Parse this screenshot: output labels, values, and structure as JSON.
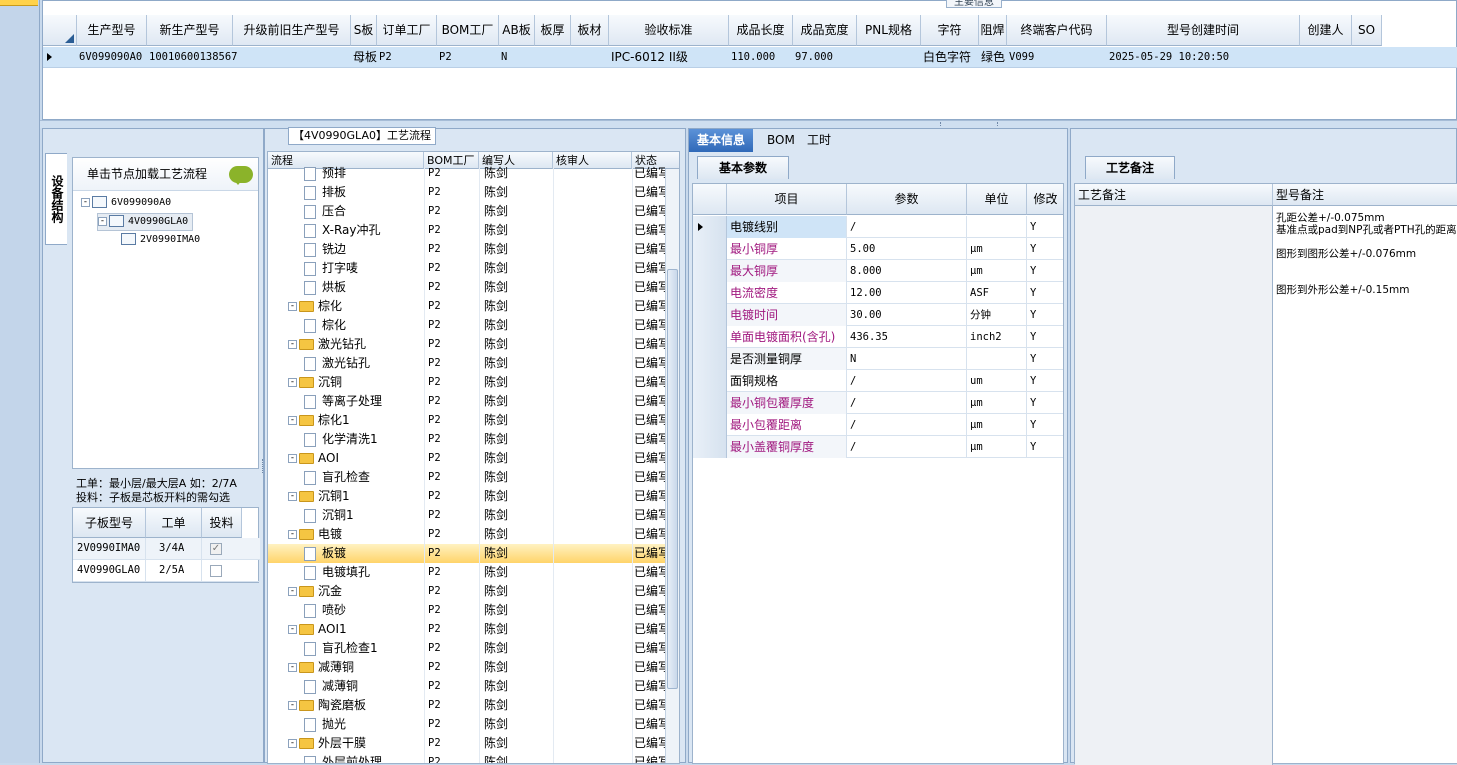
{
  "top": {
    "title_tab": "主要信息",
    "columns": [
      "生产型号",
      "新生产型号",
      "升级前旧生产型号",
      "S板",
      "订单工厂",
      "BOM工厂",
      "AB板",
      "板厚",
      "板材",
      "验收标准",
      "成品长度",
      "成品宽度",
      "PNL规格",
      "字符",
      "阻焊",
      "终端客户代码",
      "型号创建时间",
      "创建人",
      "SO"
    ],
    "row": {
      "production_model": "6V099090A0",
      "new_model": "10010600138567",
      "old_model": "",
      "s_board": "母板",
      "order_factory": "P2",
      "bom_factory": "P2",
      "ab_board": "N",
      "thickness": "",
      "material": "",
      "acceptance": "IPC-6012 II级",
      "length": "110.000",
      "width": "97.000",
      "pnl": "",
      "char": "白色字符",
      "solder": "绿色",
      "customer": "V099",
      "created_time": "2025-05-29 10:20:50",
      "creator": "",
      "so": ""
    }
  },
  "left": {
    "vertical_tab": "设备结构",
    "load_label": "单击节点加载工艺流程",
    "tree": [
      "6V099090A0",
      "4V0990GLA0",
      "2V0990IMA0"
    ],
    "info_line1": "工单：最小层/最大层A 如：2/7A",
    "info_line2": "投料：子板是芯板开料的需勾选",
    "sub_headers": [
      "子板型号",
      "工单",
      "投料"
    ],
    "sub_rows": [
      {
        "model": "2V0990IMA0",
        "order": "3/4A",
        "checked": true
      },
      {
        "model": "4V0990GLA0",
        "order": "2/5A",
        "checked": false
      }
    ]
  },
  "flow": {
    "title": "【4V0990GLA0】工艺流程",
    "headers": [
      "流程",
      "BOM工厂",
      "编写人",
      "核审人",
      "状态"
    ],
    "rows": [
      {
        "name": "预排",
        "level": 2,
        "folder": false,
        "bom": "P2",
        "writer": "陈剑",
        "reviewer": "",
        "status": "已编写"
      },
      {
        "name": "排板",
        "level": 2,
        "folder": false,
        "bom": "P2",
        "writer": "陈剑",
        "reviewer": "",
        "status": "已编写"
      },
      {
        "name": "压合",
        "level": 2,
        "folder": false,
        "bom": "P2",
        "writer": "陈剑",
        "reviewer": "",
        "status": "已编写"
      },
      {
        "name": "X-Ray冲孔",
        "level": 2,
        "folder": false,
        "bom": "P2",
        "writer": "陈剑",
        "reviewer": "",
        "status": "已编写"
      },
      {
        "name": "铣边",
        "level": 2,
        "folder": false,
        "bom": "P2",
        "writer": "陈剑",
        "reviewer": "",
        "status": "已编写"
      },
      {
        "name": "打字唛",
        "level": 2,
        "folder": false,
        "bom": "P2",
        "writer": "陈剑",
        "reviewer": "",
        "status": "已编写"
      },
      {
        "name": "烘板",
        "level": 2,
        "folder": false,
        "bom": "P2",
        "writer": "陈剑",
        "reviewer": "",
        "status": "已编写"
      },
      {
        "name": "棕化",
        "level": 1,
        "folder": true,
        "bom": "P2",
        "writer": "陈剑",
        "reviewer": "",
        "status": "已编写"
      },
      {
        "name": "棕化",
        "level": 2,
        "folder": false,
        "bom": "P2",
        "writer": "陈剑",
        "reviewer": "",
        "status": "已编写"
      },
      {
        "name": "激光钻孔",
        "level": 1,
        "folder": true,
        "bom": "P2",
        "writer": "陈剑",
        "reviewer": "",
        "status": "已编写"
      },
      {
        "name": "激光钻孔",
        "level": 2,
        "folder": false,
        "bom": "P2",
        "writer": "陈剑",
        "reviewer": "",
        "status": "已编写"
      },
      {
        "name": "沉铜",
        "level": 1,
        "folder": true,
        "bom": "P2",
        "writer": "陈剑",
        "reviewer": "",
        "status": "已编写"
      },
      {
        "name": "等离子处理",
        "level": 2,
        "folder": false,
        "bom": "P2",
        "writer": "陈剑",
        "reviewer": "",
        "status": "已编写"
      },
      {
        "name": "棕化1",
        "level": 1,
        "folder": true,
        "bom": "P2",
        "writer": "陈剑",
        "reviewer": "",
        "status": "已编写"
      },
      {
        "name": "化学清洗1",
        "level": 2,
        "folder": false,
        "bom": "P2",
        "writer": "陈剑",
        "reviewer": "",
        "status": "已编写"
      },
      {
        "name": "AOI",
        "level": 1,
        "folder": true,
        "bom": "P2",
        "writer": "陈剑",
        "reviewer": "",
        "status": "已编写"
      },
      {
        "name": "盲孔检查",
        "level": 2,
        "folder": false,
        "bom": "P2",
        "writer": "陈剑",
        "reviewer": "",
        "status": "已编写"
      },
      {
        "name": "沉铜1",
        "level": 1,
        "folder": true,
        "bom": "P2",
        "writer": "陈剑",
        "reviewer": "",
        "status": "已编写"
      },
      {
        "name": "沉铜1",
        "level": 2,
        "folder": false,
        "bom": "P2",
        "writer": "陈剑",
        "reviewer": "",
        "status": "已编写"
      },
      {
        "name": "电镀",
        "level": 1,
        "folder": true,
        "bom": "P2",
        "writer": "陈剑",
        "reviewer": "",
        "status": "已编写"
      },
      {
        "name": "板镀",
        "level": 2,
        "folder": false,
        "bom": "P2",
        "writer": "陈剑",
        "reviewer": "",
        "status": "已编写",
        "selected": true
      },
      {
        "name": "电镀填孔",
        "level": 2,
        "folder": false,
        "bom": "P2",
        "writer": "陈剑",
        "reviewer": "",
        "status": "已编写"
      },
      {
        "name": "沉金",
        "level": 1,
        "folder": true,
        "bom": "P2",
        "writer": "陈剑",
        "reviewer": "",
        "status": "已编写"
      },
      {
        "name": "喷砂",
        "level": 2,
        "folder": false,
        "bom": "P2",
        "writer": "陈剑",
        "reviewer": "",
        "status": "已编写"
      },
      {
        "name": "AOI1",
        "level": 1,
        "folder": true,
        "bom": "P2",
        "writer": "陈剑",
        "reviewer": "",
        "status": "已编写"
      },
      {
        "name": "盲孔检查1",
        "level": 2,
        "folder": false,
        "bom": "P2",
        "writer": "陈剑",
        "reviewer": "",
        "status": "已编写"
      },
      {
        "name": "减薄铜",
        "level": 1,
        "folder": true,
        "bom": "P2",
        "writer": "陈剑",
        "reviewer": "",
        "status": "已编写"
      },
      {
        "name": "减薄铜",
        "level": 2,
        "folder": false,
        "bom": "P2",
        "writer": "陈剑",
        "reviewer": "",
        "status": "已编写"
      },
      {
        "name": "陶瓷磨板",
        "level": 1,
        "folder": true,
        "bom": "P2",
        "writer": "陈剑",
        "reviewer": "",
        "status": "已编写"
      },
      {
        "name": "抛光",
        "level": 2,
        "folder": false,
        "bom": "P2",
        "writer": "陈剑",
        "reviewer": "",
        "status": "已编写"
      },
      {
        "name": "外层干膜",
        "level": 1,
        "folder": true,
        "bom": "P2",
        "writer": "陈剑",
        "reviewer": "",
        "status": "已编写"
      },
      {
        "name": "外层前处理",
        "level": 2,
        "folder": false,
        "bom": "P2",
        "writer": "陈剑",
        "reviewer": "",
        "status": "已编写"
      }
    ]
  },
  "info": {
    "tabs": [
      "基本信息",
      "BOM",
      "工时"
    ],
    "sub_tab": "基本参数",
    "headers": [
      "项目",
      "参数",
      "单位",
      "修改"
    ],
    "rows": [
      {
        "item": "电镀线别",
        "value": "/",
        "unit": "",
        "mod": "Y",
        "highlight": false,
        "current": true
      },
      {
        "item": "最小铜厚",
        "value": "5.00",
        "unit": "μm",
        "mod": "Y",
        "highlight": true
      },
      {
        "item": "最大铜厚",
        "value": "8.000",
        "unit": "μm",
        "mod": "Y",
        "highlight": true
      },
      {
        "item": "电流密度",
        "value": "12.00",
        "unit": "ASF",
        "mod": "Y",
        "highlight": true
      },
      {
        "item": "电镀时间",
        "value": "30.00",
        "unit": "分钟",
        "mod": "Y",
        "highlight": true
      },
      {
        "item": "单面电镀面积(含孔)",
        "value": "436.35",
        "unit": "inch2",
        "mod": "Y",
        "highlight": true
      },
      {
        "item": "是否测量铜厚",
        "value": "N",
        "unit": "",
        "mod": "Y",
        "highlight": false
      },
      {
        "item": "面铜规格",
        "value": "/",
        "unit": "um",
        "mod": "Y",
        "highlight": false
      },
      {
        "item": "最小铜包覆厚度",
        "value": "/",
        "unit": "μm",
        "mod": "Y",
        "highlight": true
      },
      {
        "item": "最小包覆距离",
        "value": "/",
        "unit": "μm",
        "mod": "Y",
        "highlight": true
      },
      {
        "item": "最小盖覆铜厚度",
        "value": "/",
        "unit": "μm",
        "mod": "Y",
        "highlight": true
      }
    ]
  },
  "notes": {
    "tab": "工艺备注",
    "col1": "工艺备注",
    "col2": "型号备注",
    "remarks": [
      "孔距公差+/-0.075mm",
      "基准点或pad到NP孔或者PTH孔的距离",
      "",
      "图形到图形公差+/-0.076mm",
      "",
      "",
      "图形到外形公差+/-0.15mm"
    ]
  },
  "colors": {
    "highlight_text": "#a0187f",
    "selected_row": "#cfe4f7",
    "tab_active": "#2f69b8"
  }
}
